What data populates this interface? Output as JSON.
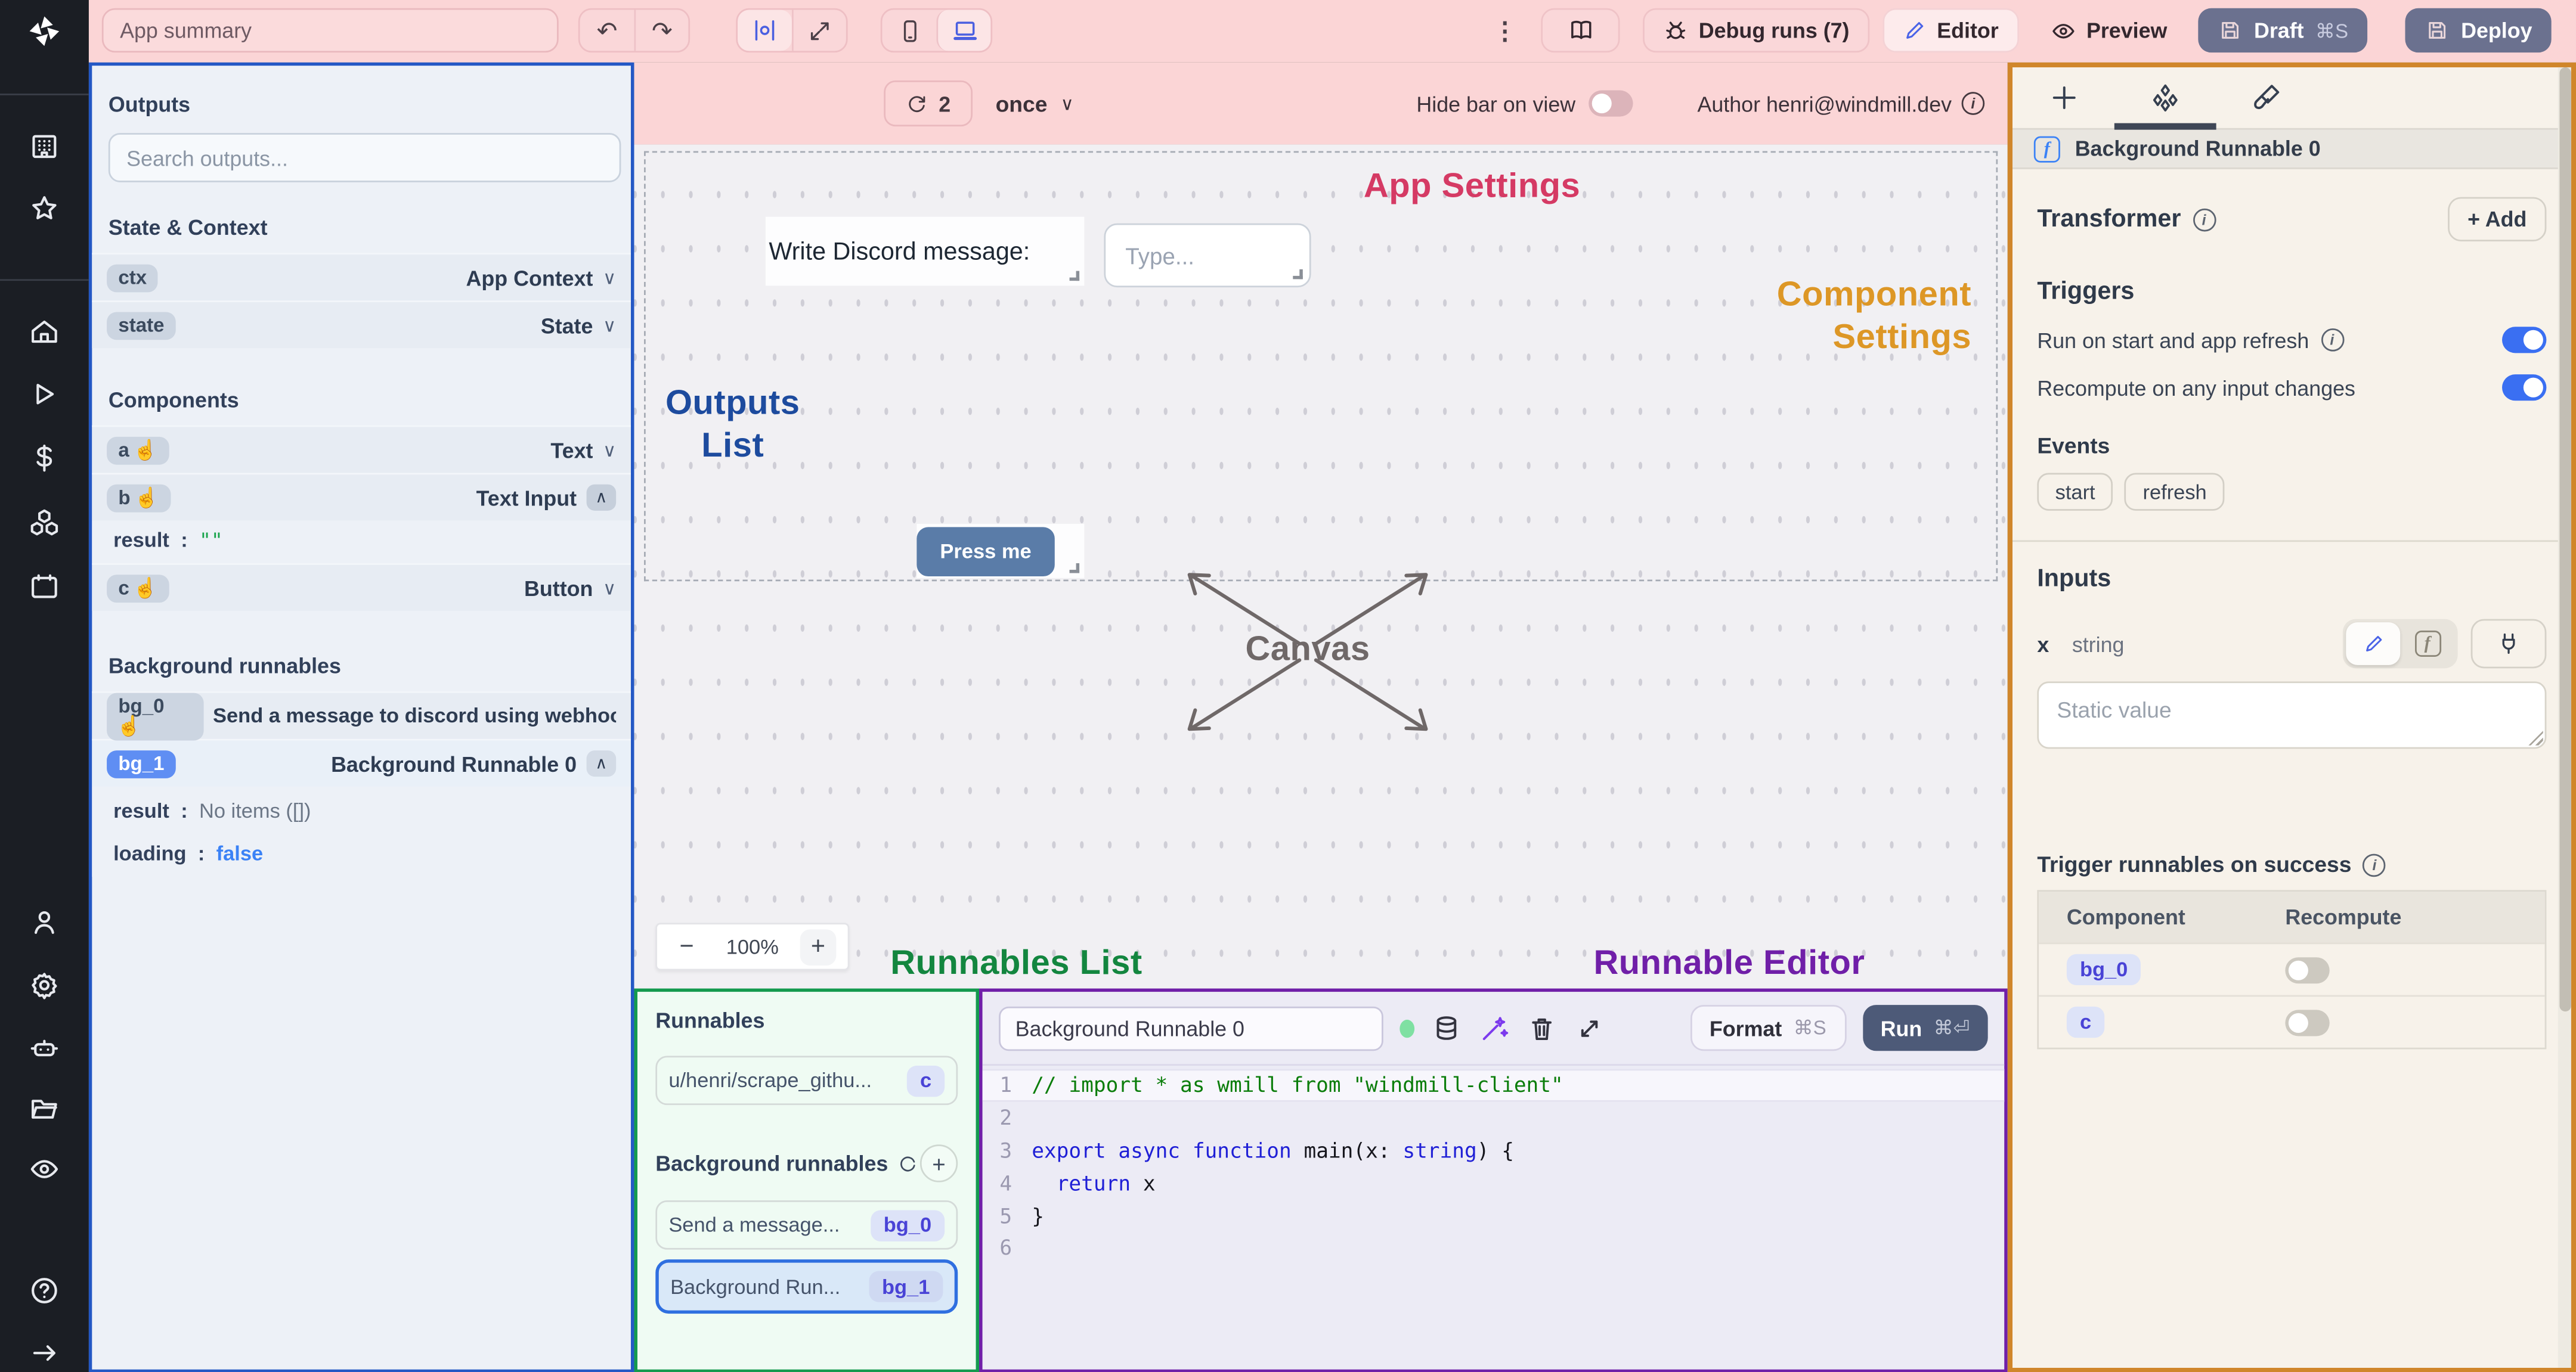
{
  "glyphs": {
    "kebab": "⋮",
    "chevron_down": "∨",
    "chevron_up": "∧",
    "hand": "☝",
    "undo": "↶",
    "redo": "↷",
    "info": "i",
    "plus": "+",
    "minus": "−",
    "colon": ":",
    "arrow_right": "→",
    "question": "?",
    "gear": "⚙",
    "dollar": "$"
  },
  "topbar": {
    "app_summary_placeholder": "App summary",
    "debug_runs_label": "Debug runs (7)",
    "editor_label": "Editor",
    "preview_label": "Preview",
    "draft_label": "Draft",
    "draft_shortcut": "⌘S",
    "deploy_label": "Deploy"
  },
  "outputs_panel": {
    "title": "Outputs",
    "search_placeholder": "Search outputs...",
    "state_context_title": "State & Context",
    "ctx_id": "ctx",
    "ctx_type": "App Context",
    "state_id": "state",
    "state_type": "State",
    "components_title": "Components",
    "a_id": "a",
    "a_type": "Text",
    "b_id": "b",
    "b_type": "Text Input",
    "b_result_key": "result",
    "b_result_value": "\"\"",
    "c_id": "c",
    "c_type": "Button",
    "background_title": "Background runnables",
    "bg0_id": "bg_0",
    "bg0_label": "Send a message to discord using webhoo",
    "bg1_id": "bg_1",
    "bg1_label": "Background Runnable 0",
    "bg1_result_key": "result",
    "bg1_result_value": "No items ([])",
    "bg1_loading_key": "loading",
    "bg1_loading_value": "false"
  },
  "canvas": {
    "bar": {
      "refresh_count": "2",
      "mode": "once",
      "hide_bar_label": "Hide bar on view",
      "author": "Author henri@windmill.dev"
    },
    "labels": {
      "app_settings": "App Settings",
      "component_settings_l1": "Component",
      "component_settings_l2": "Settings",
      "outputs_l1": "Outputs",
      "outputs_l2": "List",
      "canvas": "Canvas",
      "runnables_list": "Runnables List",
      "runnable_editor": "Runnable Editor"
    },
    "components": {
      "discord_label": "Write Discord message:",
      "type_placeholder": "Type...",
      "press_me": "Press me"
    },
    "zoom": {
      "minus": "−",
      "level": "100%",
      "plus": "+"
    },
    "colors": {
      "app_settings": "#d53a64",
      "component_settings": "#dd9726",
      "outputs_list": "#1d4b9e",
      "canvas": "#6f6868",
      "runnables_list": "#13863f",
      "runnable_editor": "#701fa8"
    }
  },
  "runnables_panel": {
    "title": "Runnables",
    "item1_label": "u/henri/scrape_githu...",
    "item1_badge": "c",
    "background_title": "Background runnables",
    "item2_label": "Send a message...",
    "item2_badge": "bg_0",
    "item3_label": "Background Run...",
    "item3_badge": "bg_1"
  },
  "editor_panel": {
    "name_value": "Background Runnable 0",
    "format_label": "Format",
    "format_shortcut": "⌘S",
    "run_label": "Run",
    "run_shortcut": "⌘⏎",
    "code_lines": [
      {
        "num": "1",
        "highlight": true,
        "tokens": [
          [
            "// import * as wmill from \"windmill-client\"",
            "tok-comment"
          ]
        ]
      },
      {
        "num": "2",
        "highlight": false,
        "tokens": []
      },
      {
        "num": "3",
        "highlight": false,
        "tokens": [
          [
            "export",
            "tok-kw"
          ],
          [
            " ",
            ""
          ],
          [
            "async",
            "tok-kw"
          ],
          [
            " ",
            ""
          ],
          [
            "function",
            "tok-kw"
          ],
          [
            " main(x: ",
            "tok-plain"
          ],
          [
            "string",
            "tok-kw"
          ],
          [
            ") {",
            "tok-plain"
          ]
        ]
      },
      {
        "num": "4",
        "highlight": false,
        "tokens": [
          [
            "  ",
            ""
          ],
          [
            "return",
            "tok-kw"
          ],
          [
            " x",
            "tok-plain"
          ]
        ]
      },
      {
        "num": "5",
        "highlight": false,
        "tokens": [
          [
            "}",
            "tok-plain"
          ]
        ]
      },
      {
        "num": "6",
        "highlight": false,
        "tokens": []
      }
    ]
  },
  "right_panel": {
    "header_title": "Background Runnable 0",
    "transformer_title": "Transformer",
    "add_label": "+ Add",
    "triggers_title": "Triggers",
    "trigger_start_label": "Run on start and app refresh",
    "trigger_recompute_label": "Recompute on any input changes",
    "events_title": "Events",
    "event_start": "start",
    "event_refresh": "refresh",
    "inputs_title": "Inputs",
    "input_name": "x",
    "input_type": "string",
    "static_placeholder": "Static value",
    "trigger_success_title": "Trigger runnables on success",
    "table_col1": "Component",
    "table_col2": "Recompute",
    "table_rows": [
      {
        "badge": "bg_0"
      },
      {
        "badge": "c"
      }
    ]
  }
}
